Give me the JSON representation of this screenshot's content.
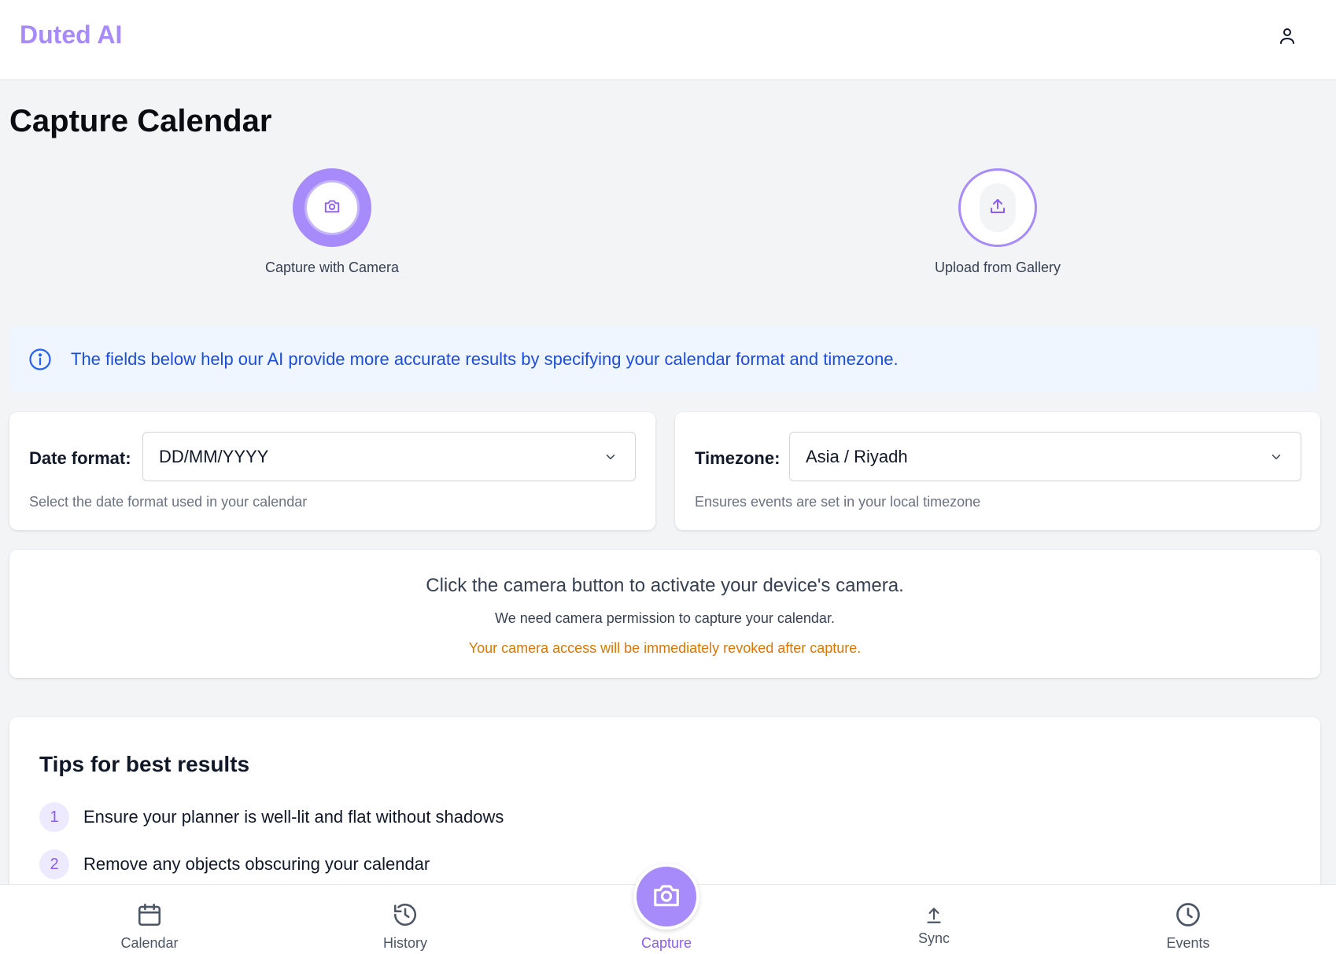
{
  "header": {
    "brand": "Duted AI",
    "user_icon": "user-icon"
  },
  "page": {
    "title": "Capture Calendar"
  },
  "actions": {
    "camera_label": "Capture with Camera",
    "upload_label": "Upload from Gallery"
  },
  "info": {
    "text": "The fields below help our AI provide more accurate results by specifying your calendar format and timezone."
  },
  "date_format": {
    "label": "Date format:",
    "value": "DD/MM/YYYY",
    "help": "Select the date format used in your calendar"
  },
  "timezone": {
    "label": "Timezone:",
    "value": "Asia / Riyadh",
    "help": "Ensures events are set in your local timezone"
  },
  "camera_message": {
    "main": "Click the camera button to activate your device's camera.",
    "sub": "We need camera permission to capture your calendar.",
    "warning": "Your camera access will be immediately revoked after capture."
  },
  "tips": {
    "title": "Tips for best results",
    "items": [
      {
        "num": "1",
        "text": "Ensure your planner is well-lit and flat without shadows"
      },
      {
        "num": "2",
        "text": "Remove any objects obscuring your calendar"
      }
    ]
  },
  "nav": {
    "calendar": "Calendar",
    "history": "History",
    "capture": "Capture",
    "sync": "Sync",
    "events": "Events"
  },
  "colors": {
    "accent": "#a78bfa",
    "info_bg": "#eff6ff",
    "info_text": "#1d4ed8",
    "warning": "#d97706"
  }
}
